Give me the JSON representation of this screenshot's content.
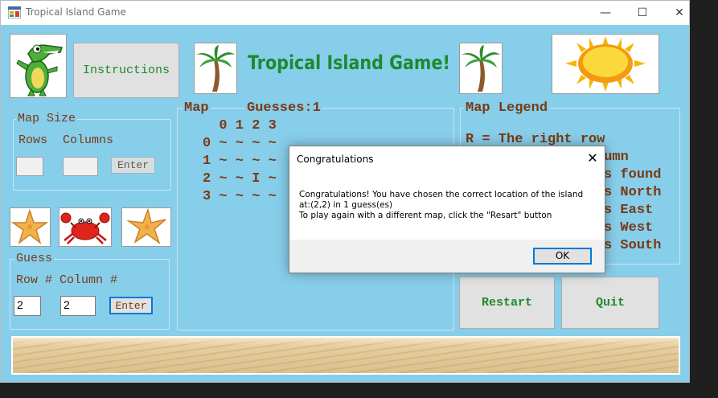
{
  "window": {
    "title": "Tropical Island Game",
    "minimize_glyph": "—",
    "maximize_glyph": "☐",
    "close_glyph": "✕"
  },
  "header": {
    "instructions_label": "Instructions",
    "game_title": "Tropical Island Game!"
  },
  "map_size": {
    "title": "Map Size",
    "rows_label": "Rows",
    "columns_label": "Columns",
    "rows_value": "",
    "columns_value": "",
    "enter_label": "Enter"
  },
  "map": {
    "title": "Map",
    "guesses_label": "Guesses:1",
    "header_row": "  0 1 2 3",
    "rows": [
      "0 ~ ~ ~ ~",
      "1 ~ ~ ~ ~",
      "2 ~ ~ I ~",
      "3 ~ ~ ~ ~"
    ]
  },
  "legend": {
    "title": "Map Legend",
    "lines": [
      "R = The right row",
      "    olumn",
      "    is found",
      "    is North",
      "    is East",
      "    is West",
      "    is South"
    ]
  },
  "guess": {
    "title": "Guess",
    "row_label": "Row #",
    "column_label": "Column #",
    "row_value": "2",
    "column_value": "2",
    "enter_label": "Enter"
  },
  "buttons": {
    "restart_label": "Restart",
    "quit_label": "Quit"
  },
  "dialog": {
    "title": "Congratulations",
    "close_glyph": "✕",
    "message_lines": [
      "Congratulations! You have chosen the correct location of the island",
      "at:(2,2) in 1 guess(es)",
      "To play again with a different map, click the \"Resart\" button"
    ],
    "ok_label": "OK"
  },
  "colors": {
    "background": "#87ceeb",
    "accent_green": "#1c8a2e",
    "text_brown": "#7b3a13"
  },
  "icons": [
    "crocodile-icon",
    "palm-tree-icon",
    "sun-icon",
    "starfish-icon",
    "crab-icon"
  ]
}
